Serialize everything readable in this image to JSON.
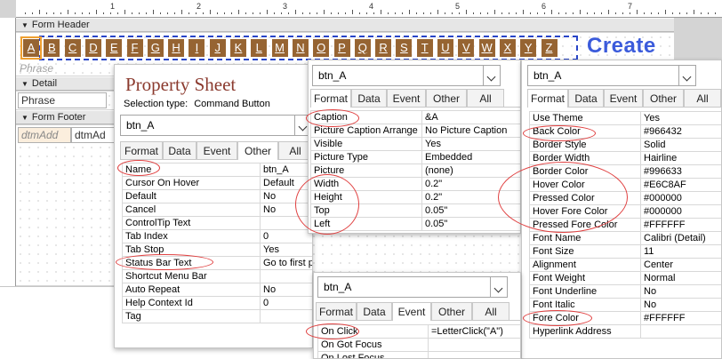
{
  "form": {
    "sections": {
      "form_header": "Form Header",
      "detail": "Detail",
      "form_footer": "Form Footer"
    },
    "letters": [
      "A",
      "B",
      "C",
      "D",
      "E",
      "F",
      "G",
      "H",
      "I",
      "J",
      "K",
      "L",
      "M",
      "N",
      "O",
      "P",
      "Q",
      "R",
      "S",
      "T",
      "U",
      "V",
      "W",
      "X",
      "Y",
      "Z"
    ],
    "create_label": "Create",
    "phrase_header_ghost": "Phrase",
    "phrase_field": "Phrase",
    "footer_field_1": "dtmAdd",
    "footer_field_2": "dtmAd",
    "ruler_numbers": [
      "1",
      "2",
      "3",
      "4",
      "5",
      "6",
      "7"
    ],
    "colors": {
      "button_back": "#966432",
      "button_border": "#996633",
      "group_outline": "#2845c8",
      "create_text": "#3b5bdb"
    }
  },
  "panel_main": {
    "title": "Property Sheet",
    "selection_type_label": "Selection type:",
    "selection_type_value": "Command Button",
    "selected_object": "btn_A",
    "tabs": [
      "Format",
      "Data",
      "Event",
      "Other",
      "All"
    ],
    "active_tab": "Other",
    "rows": [
      [
        "Name",
        "btn_A"
      ],
      [
        "Cursor On Hover",
        "Default"
      ],
      [
        "Default",
        "No"
      ],
      [
        "Cancel",
        "No"
      ],
      [
        "ControlTip Text",
        ""
      ],
      [
        "Tab Index",
        "0"
      ],
      [
        "Tab Stop",
        "Yes"
      ],
      [
        "Status Bar Text",
        "Go to first phrase starting with A"
      ],
      [
        "Shortcut Menu Bar",
        ""
      ],
      [
        "Auto Repeat",
        "No"
      ],
      [
        "Help Context Id",
        "0"
      ],
      [
        "Tag",
        ""
      ]
    ]
  },
  "panel_format": {
    "selected_object": "btn_A",
    "tabs": [
      "Format",
      "Data",
      "Event",
      "Other",
      "All"
    ],
    "active_tab": "Format",
    "rows": [
      [
        "Caption",
        "&A"
      ],
      [
        "Picture Caption Arrange",
        "No Picture Caption"
      ],
      [
        "Visible",
        "Yes"
      ],
      [
        "Picture Type",
        "Embedded"
      ],
      [
        "Picture",
        "(none)"
      ],
      [
        "Width",
        "0.2\""
      ],
      [
        "Height",
        "0.2\""
      ],
      [
        "Top",
        "0.05\""
      ],
      [
        "Left",
        "0.05\""
      ]
    ]
  },
  "panel_colors": {
    "selected_object": "btn_A",
    "tabs": [
      "Format",
      "Data",
      "Event",
      "Other",
      "All"
    ],
    "active_tab": "Format",
    "rows": [
      [
        "Use Theme",
        "Yes"
      ],
      [
        "Back Color",
        "#966432"
      ],
      [
        "Border Style",
        "Solid"
      ],
      [
        "Border Width",
        "Hairline"
      ],
      [
        "Border Color",
        "#996633"
      ],
      [
        "Hover Color",
        "#E6C8AF"
      ],
      [
        "Pressed Color",
        "#000000"
      ],
      [
        "Hover Fore Color",
        "#000000"
      ],
      [
        "Pressed Fore Color",
        "#FFFFFF"
      ],
      [
        "Font Name",
        "Calibri (Detail)"
      ],
      [
        "Font Size",
        "11"
      ],
      [
        "Alignment",
        "Center"
      ],
      [
        "Font Weight",
        "Normal"
      ],
      [
        "Font Underline",
        "No"
      ],
      [
        "Font Italic",
        "No"
      ],
      [
        "Fore Color",
        "#FFFFFF"
      ],
      [
        "Hyperlink Address",
        ""
      ]
    ]
  },
  "panel_event": {
    "selected_object": "btn_A",
    "tabs": [
      "Format",
      "Data",
      "Event",
      "Other",
      "All"
    ],
    "active_tab": "Event",
    "rows": [
      [
        "On Click",
        "=LetterClick(\"A\")"
      ],
      [
        "On Got Focus",
        ""
      ],
      [
        "On Lost Focus",
        ""
      ]
    ]
  },
  "annotation_color": "#e04040"
}
